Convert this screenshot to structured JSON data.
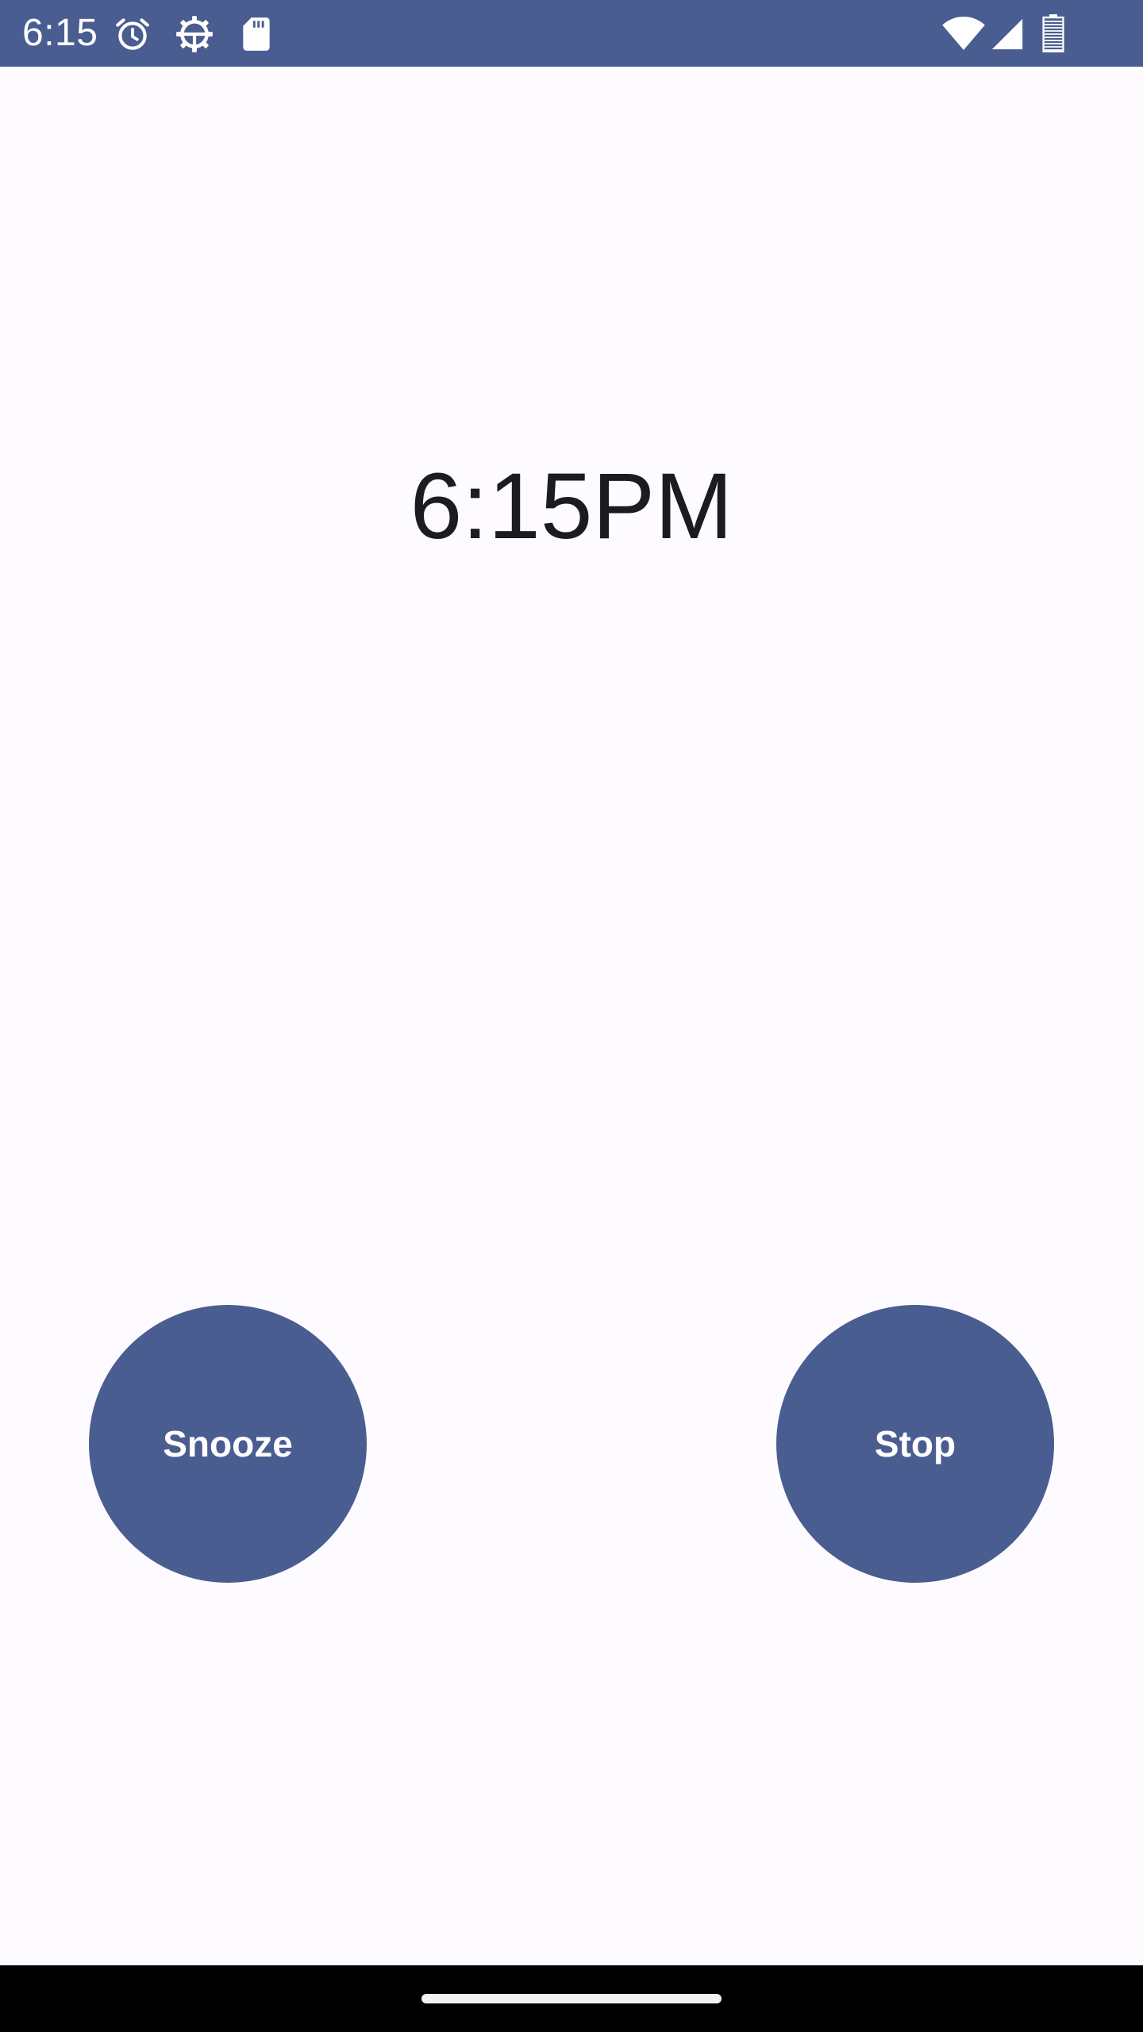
{
  "status_bar": {
    "time": "6:15",
    "left_icons": [
      "alarm-clock-icon",
      "settings-gear-icon",
      "sd-card-icon"
    ],
    "right_icons": [
      "wifi-icon",
      "cell-signal-icon",
      "battery-icon"
    ],
    "background_color": "#4a5d91"
  },
  "alarm": {
    "time": "6:15PM"
  },
  "actions": {
    "snooze_label": "Snooze",
    "stop_label": "Stop",
    "button_color": "#4a5d91"
  },
  "colors": {
    "background": "#fdfbff",
    "text": "#1c1b1f",
    "nav_bar": "#000000"
  }
}
